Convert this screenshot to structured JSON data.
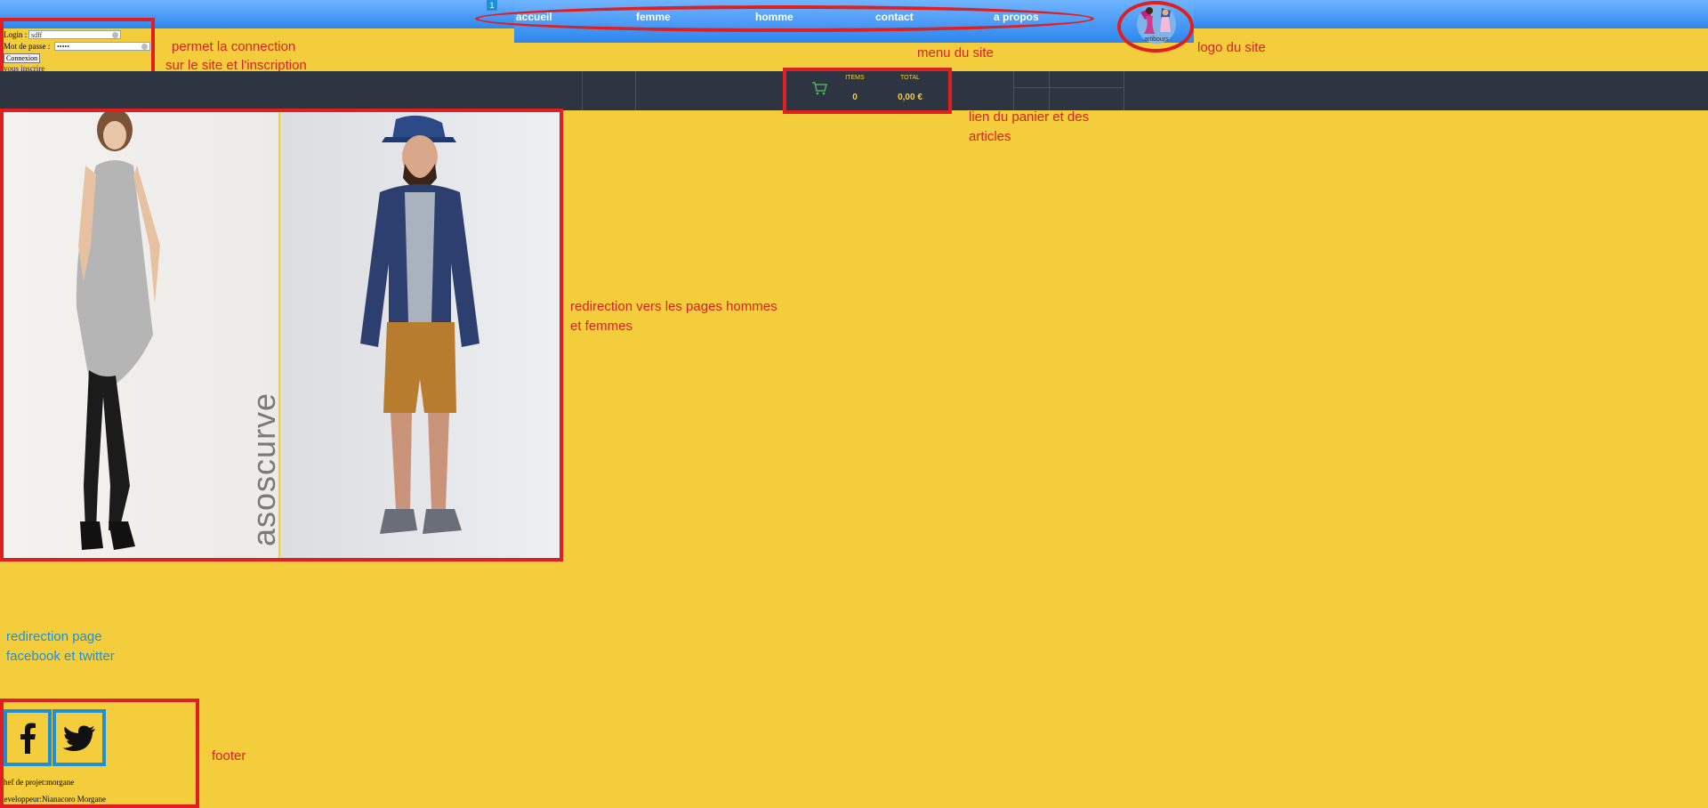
{
  "top_marker": "1",
  "nav": {
    "items": [
      "accueil",
      "femme",
      "homme",
      "contact",
      "a propos"
    ]
  },
  "logo": {
    "text": "artibours"
  },
  "login": {
    "login_label": "Login :",
    "login_value": "sdff",
    "password_label": "Mot de passe :",
    "password_value": "•••••",
    "submit_label": "Connexion",
    "register_link": "vous inscrire"
  },
  "cart": {
    "items_label": "ITEMS",
    "total_label": "TOTAL",
    "items_value": "0",
    "total_value": "0,00 €"
  },
  "hero": {
    "brand": "asoscurve"
  },
  "annotations": {
    "login": [
      "permet la connection",
      "sur le site et l'inscription"
    ],
    "menu": "menu du site",
    "logo": "logo du site",
    "cart": [
      "lien du panier et des",
      "articles"
    ],
    "hero": [
      "redirection vers les pages hommes",
      "et femmes"
    ],
    "social": [
      "redirection page",
      "facebook et twitter"
    ],
    "footer": "footer"
  },
  "footer": {
    "line1": "chef de projet:morgane",
    "line2": "developpeur:Nianacoro Morgane"
  },
  "colors": {
    "background": "#f4cd3c",
    "annotation_red": "#e02020",
    "annotation_blue": "#1e90d6",
    "dark_bar": "#2e3542"
  }
}
